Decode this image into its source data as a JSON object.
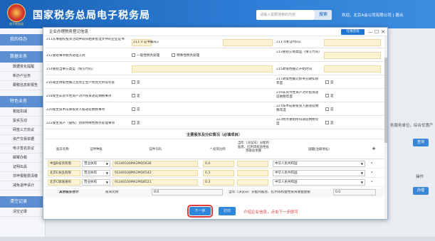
{
  "header": {
    "emblem_text": "电子税务局",
    "title": "国家税务总局电子税务局",
    "search_placeholder": "请输入需要搜索的内容",
    "search_button": "搜索",
    "user_text": "欢迎，北京A会公司有限公司 | 退出"
  },
  "sidebar": {
    "sections": [
      {
        "title": "我的待办",
        "items": []
      },
      {
        "title": "数据业务",
        "items": [
          "数据变化提醒",
          "新办户业务",
          "跟税信息新报告"
        ]
      },
      {
        "title": "特色业务",
        "items": [
          "税延扣减",
          "投资互动",
          "网签三方协议",
          "资产交易单据",
          "电子签名协议",
          "邮寄办税",
          "证明出具",
          "非申报税费清缴",
          "减免退申请计"
        ]
      },
      {
        "title": "清空记录",
        "items": [
          "清空记录"
        ]
      }
    ]
  },
  "background": {
    "right_text": "务服务单位，综合优惠产业务等业务，主要为全体中联系件税务职业...",
    "query_button": "查询",
    "col_header": "操作",
    "action_button": "办理"
  },
  "modal": {
    "title": "企业办理税务登记信息",
    "help_button": "在线咨询",
    "win_controls": [
      "—",
      "☐",
      "✕"
    ],
    "rows": [
      {
        "left_label": "211从事股权投资活动并取得相关批准文件的企业证书",
        "mid_label": "211-3 证书编号2",
        "right_label": "211-4发证时间2"
      },
      {
        "left_label": "212重组事项税务处理方式",
        "opt1": "一般性税务处理",
        "opt2": "特殊性税务处理",
        "right_label": "213重组交易类型（填写代码）"
      },
      {
        "left_label": "214重组当事方类型（填写代码）",
        "right_label": "215政策性搬迁开始时间"
      },
      {
        "left_label": "216发生政策性搬迁且停止生产经营无所得年度",
        "opt1": "是",
        "right_label": "217政策性搬迁损失分期扣除年度",
        "opt2": "是"
      },
      {
        "left_label": "218发生非货币性资产对外投资递延纳税事项",
        "opt1": "是",
        "right_label": "219非货币性资产对外投资递延纳税年度",
        "opt2": "是"
      },
      {
        "left_label": "220发生技术成果投资入股递延纳税事项",
        "opt1": "是",
        "right_label": "221技术成果投资入股递延纳税年度",
        "opt2": "是"
      },
      {
        "left_label": "222发生资产（股权）划转特殊性税务处理事项",
        "opt1": "是",
        "right_label": "223债务重组所得递延纳税年度",
        "opt2": "是"
      }
    ],
    "section_title": "主要股东及分红情况（必填项目）",
    "table_headers": [
      "股东名称",
      "证件种类",
      "证件号码",
      "* 投资比例",
      "当年（决议日）分配的股息、红利等权益性投资收益金额",
      "国籍(注册地址)",
      "+"
    ],
    "shareholders": [
      {
        "name": "中国B投资有限",
        "id_type": "营业执照",
        "id_no": "91340100MA2MQ5636",
        "ratio": "0.4",
        "dividend": "",
        "nationality": "中华人民共和国",
        "action": "-"
      },
      {
        "name": "北京E食品有限",
        "id_type": "营业执照",
        "id_no": "91340100MA2MQ6542",
        "ratio": "0.3",
        "dividend": "",
        "nationality": "中华人民共和国",
        "action": "-"
      },
      {
        "name": "北京C联发展有",
        "id_type": "营业执照",
        "id_no": "91340100MA2MQ8521",
        "ratio": "0.3",
        "dividend": "",
        "nationality": "中华人民共和国",
        "action": "-"
      }
    ],
    "total": {
      "label": "其余股东合计",
      "ratio_label": "投资比例",
      "ratio_value": "0.0",
      "dividend_label": "当年（决议日）分配的股息、红利等权益性投资收益金额",
      "dividend_value": "0.0"
    },
    "next_button": "下一步",
    "print_button": "打印",
    "hint": "介绍企业信息，点击下一步即可"
  }
}
